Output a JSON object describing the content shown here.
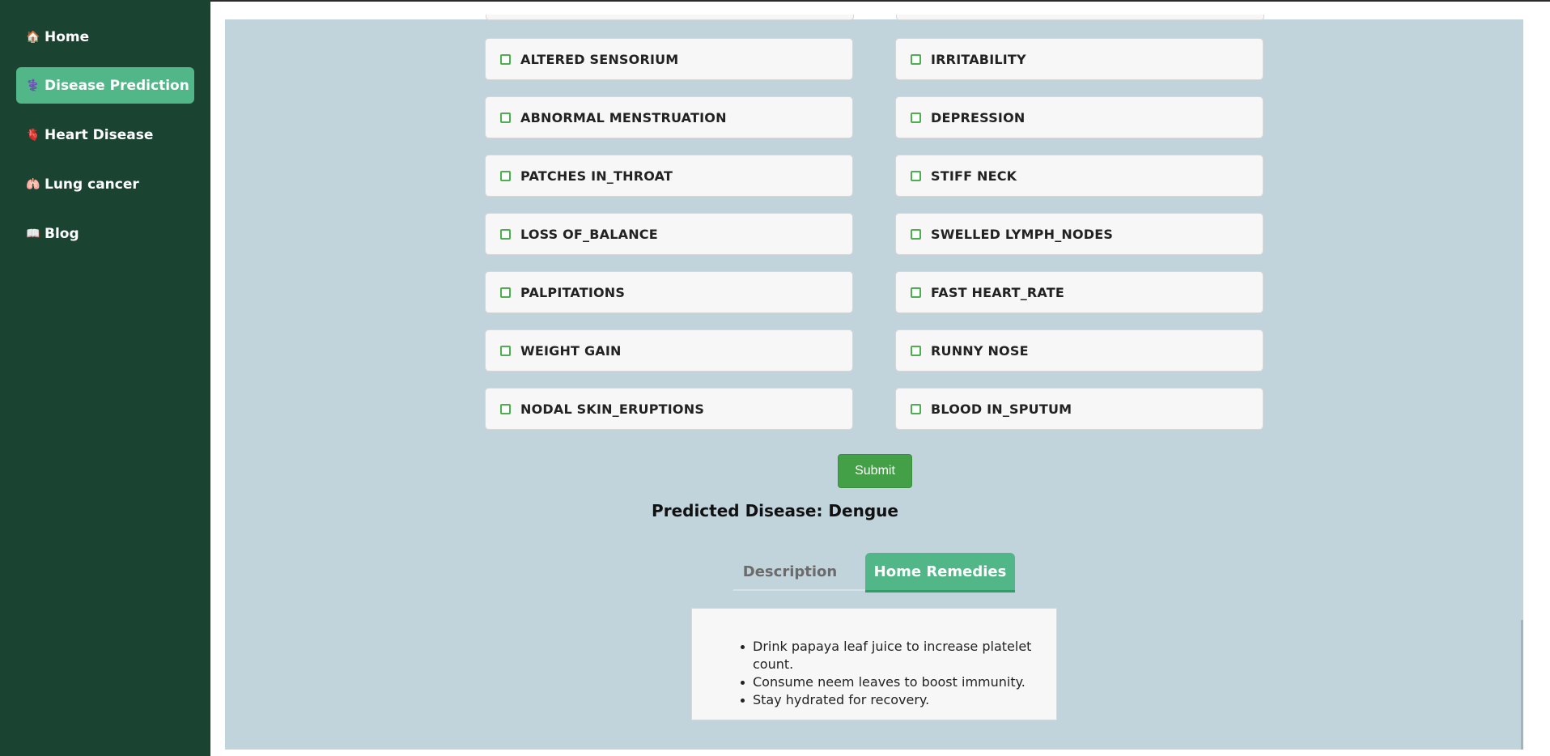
{
  "sidebar": {
    "items": [
      {
        "label": "Home",
        "icon": "house-icon",
        "glyph": "🏠",
        "active": false
      },
      {
        "label": "Disease Prediction",
        "icon": "medical-symbol-icon",
        "glyph": "⚕️",
        "active": true
      },
      {
        "label": "Heart Disease",
        "icon": "heart-icon",
        "glyph": "🫀",
        "active": false
      },
      {
        "label": "Lung cancer",
        "icon": "lungs-icon",
        "glyph": "🫁",
        "active": false
      },
      {
        "label": "Blog",
        "icon": "book-icon",
        "glyph": "📖",
        "active": false
      }
    ]
  },
  "symptoms": {
    "left": [
      "ALTERED SENSORIUM",
      "ABNORMAL MENSTRUATION",
      "PATCHES IN_THROAT",
      "LOSS OF_BALANCE",
      "PALPITATIONS",
      "WEIGHT GAIN",
      "NODAL SKIN_ERUPTIONS"
    ],
    "right": [
      "IRRITABILITY",
      "DEPRESSION",
      "STIFF NECK",
      "SWELLED LYMPH_NODES",
      "FAST HEART_RATE",
      "RUNNY NOSE",
      "BLOOD IN_SPUTUM"
    ]
  },
  "form": {
    "submit_label": "Submit"
  },
  "result": {
    "predicted_text": "Predicted Disease: Dengue"
  },
  "tabs": {
    "description": "Description",
    "home_remedies": "Home Remedies",
    "active": "home_remedies"
  },
  "remedies": [
    "Drink papaya leaf juice to increase platelet count.",
    "Consume neem leaves to boost immunity.",
    "Stay hydrated for recovery."
  ],
  "colors": {
    "sidebar_bg": "#1b4332",
    "accent": "#52b788",
    "main_bg": "#c1d4dc",
    "submit": "#43a047",
    "checkbox_border": "#4caf50"
  }
}
